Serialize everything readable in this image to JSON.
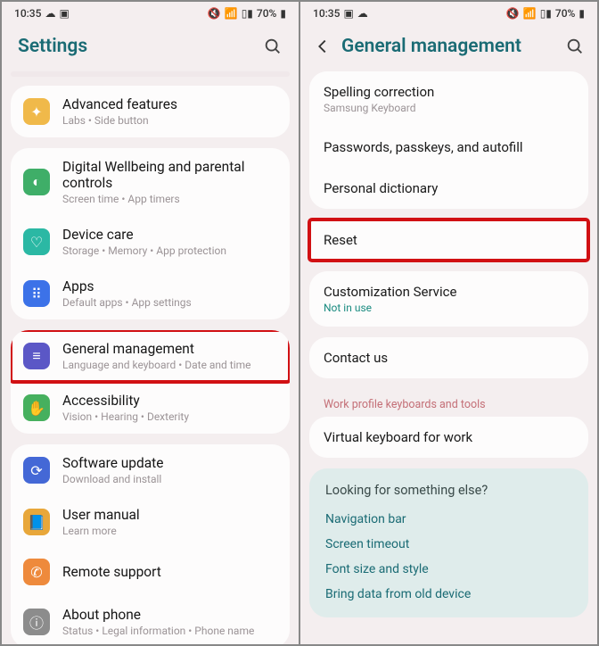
{
  "status": {
    "time": "10:35",
    "battery": "70%"
  },
  "left": {
    "title": "Settings",
    "topSpacer": true,
    "groups": [
      {
        "items": [
          {
            "icon": "gold",
            "glyph": "✦",
            "iconName": "star-icon",
            "name": "advanced-features",
            "title": "Advanced features",
            "sub": "Labs  •  Side button"
          }
        ]
      },
      {
        "items": [
          {
            "icon": "green",
            "glyph": "◐",
            "iconName": "wellbeing-icon",
            "name": "digital-wellbeing",
            "title": "Digital Wellbeing and parental controls",
            "sub": "Screen time  •  App timers"
          },
          {
            "icon": "teal",
            "glyph": "♡",
            "iconName": "device-care-icon",
            "name": "device-care",
            "title": "Device care",
            "sub": "Storage  •  Memory  •  App protection"
          },
          {
            "icon": "blue",
            "glyph": "⠿",
            "iconName": "apps-icon",
            "name": "apps",
            "title": "Apps",
            "sub": "Default apps  •  App settings"
          }
        ]
      },
      {
        "highlight": true,
        "items": [
          {
            "icon": "purple",
            "glyph": "≡",
            "iconName": "general-management-icon",
            "name": "general-management",
            "title": "General management",
            "sub": "Language and keyboard  •  Date and time"
          }
        ],
        "extra": [
          {
            "icon": "green2",
            "glyph": "✋",
            "iconName": "accessibility-icon",
            "name": "accessibility",
            "title": "Accessibility",
            "sub": "Vision  •  Hearing  •  Dexterity"
          }
        ]
      },
      {
        "items": [
          {
            "icon": "blue2",
            "glyph": "⟳",
            "iconName": "software-update-icon",
            "name": "software-update",
            "title": "Software update",
            "sub": "Download and install"
          },
          {
            "icon": "amber",
            "glyph": "📘",
            "iconName": "user-manual-icon",
            "name": "user-manual",
            "title": "User manual",
            "sub": "Learn more"
          },
          {
            "icon": "orange",
            "glyph": "✆",
            "iconName": "remote-support-icon",
            "name": "remote-support",
            "title": "Remote support",
            "sub": ""
          },
          {
            "icon": "gray",
            "glyph": "ⓘ",
            "iconName": "about-phone-icon",
            "name": "about-phone",
            "title": "About phone",
            "sub": "Status  •  Legal information  •  Phone name"
          }
        ]
      }
    ]
  },
  "right": {
    "title": "General management",
    "groups": [
      {
        "items": [
          {
            "name": "spelling-correction",
            "label": "Spelling correction",
            "sub": "Samsung Keyboard"
          },
          {
            "name": "passwords-passkeys",
            "label": "Passwords, passkeys, and autofill"
          },
          {
            "name": "personal-dictionary",
            "label": "Personal dictionary"
          }
        ]
      },
      {
        "highlight": true,
        "items": [
          {
            "name": "reset",
            "label": "Reset"
          }
        ]
      },
      {
        "items": [
          {
            "name": "customization-service",
            "label": "Customization Service",
            "sub": "Not in use",
            "subTeal": true
          }
        ]
      },
      {
        "items": [
          {
            "name": "contact-us",
            "label": "Contact us"
          }
        ]
      }
    ],
    "workSection": {
      "header": "Work profile keyboards and tools",
      "items": [
        {
          "name": "virtual-keyboard-work",
          "label": "Virtual keyboard for work"
        }
      ]
    },
    "looking": {
      "title": "Looking for something else?",
      "links": [
        {
          "name": "nav-bar-link",
          "label": "Navigation bar"
        },
        {
          "name": "screen-timeout-link",
          "label": "Screen timeout"
        },
        {
          "name": "font-size-link",
          "label": "Font size and style"
        },
        {
          "name": "bring-data-link",
          "label": "Bring data from old device"
        }
      ]
    }
  }
}
